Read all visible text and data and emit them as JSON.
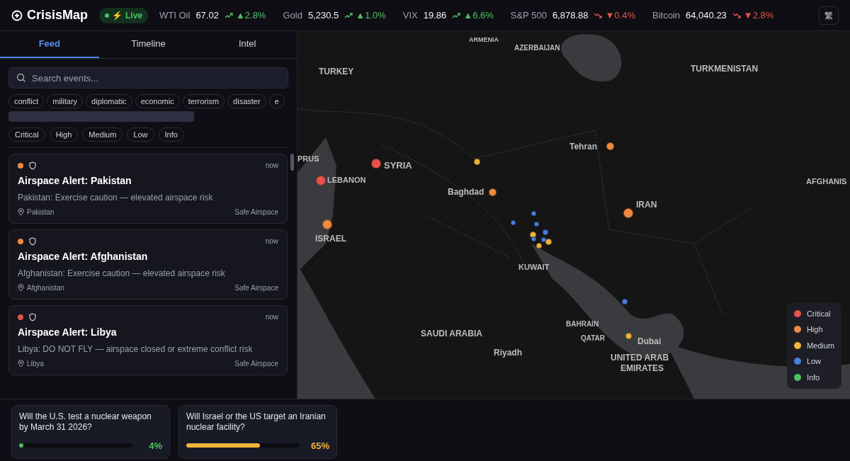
{
  "app": {
    "name": "CrisisMap",
    "status_icon": "⚡",
    "status": "Live"
  },
  "ticker": [
    {
      "label": "WTI Oil",
      "value": "67.02",
      "change": "▲2.8%",
      "kind": "up"
    },
    {
      "label": "Gold",
      "value": "5,230.5",
      "change": "▲1.0%",
      "kind": "up"
    },
    {
      "label": "VIX",
      "value": "19.86",
      "change": "▲6.6%",
      "kind": "up"
    },
    {
      "label": "S&P 500",
      "value": "6,878.88",
      "change": "▼0.4%",
      "kind": "down"
    },
    {
      "label": "Bitcoin",
      "value": "64,040.23",
      "change": "▼2.8%",
      "kind": "down"
    }
  ],
  "language_button": "繁",
  "tabs": [
    {
      "label": "Feed",
      "selected": true
    },
    {
      "label": "Timeline",
      "selected": false
    },
    {
      "label": "Intel",
      "selected": false
    }
  ],
  "search": {
    "placeholder": "Search events..."
  },
  "category_filters": [
    "conflict",
    "military",
    "diplomatic",
    "economic",
    "terrorism",
    "disaster",
    "e"
  ],
  "severity_filters": [
    "Critical",
    "High",
    "Medium",
    "Low",
    "Info"
  ],
  "events": [
    {
      "color": "#f08a3c",
      "time": "now",
      "title": "Airspace Alert: Pakistan",
      "description": "Pakistan: Exercise caution — elevated airspace risk",
      "location": "Pakistan",
      "source": "Safe Airspace"
    },
    {
      "color": "#f08a3c",
      "time": "now",
      "title": "Airspace Alert: Afghanistan",
      "description": "Afghanistan: Exercise caution — elevated airspace risk",
      "location": "Afghanistan",
      "source": "Safe Airspace"
    },
    {
      "color": "#e5534b",
      "time": "now",
      "title": "Airspace Alert: Libya",
      "description": "Libya: DO NOT FLY — airspace closed or extreme conflict risk",
      "location": "Libya",
      "source": "Safe Airspace"
    }
  ],
  "map": {
    "labels": [
      {
        "text": "ARMENIA"
      },
      {
        "text": "AZERBAIJAN"
      },
      {
        "text": "TURKEY"
      },
      {
        "text": "TURKMENISTAN"
      },
      {
        "text": "PRUS"
      },
      {
        "text": "SYRIA"
      },
      {
        "text": "Tehran"
      },
      {
        "text": "LEBANON"
      },
      {
        "text": "Baghdad"
      },
      {
        "text": "AFGHANIS"
      },
      {
        "text": "IRAN"
      },
      {
        "text": "ISRAEL"
      },
      {
        "text": "KUWAIT"
      },
      {
        "text": "BAHRAIN"
      },
      {
        "text": "SAUDI ARABIA"
      },
      {
        "text": "QATAR"
      },
      {
        "text": "Dubai"
      },
      {
        "text": "Riyadh"
      },
      {
        "text": "UNITED ARAB"
      },
      {
        "text": "EMIRATES"
      }
    ],
    "markers": [
      {
        "color": "#e5534b"
      },
      {
        "color": "#e5534b"
      },
      {
        "color": "#f08a3c"
      },
      {
        "color": "#f08a3c"
      },
      {
        "color": "#f08a3c"
      },
      {
        "color": "#f08a3c"
      },
      {
        "color": "#f2b53a"
      },
      {
        "color": "#4a7fe0"
      },
      {
        "color": "#4a7fe0"
      },
      {
        "color": "#4a7fe0"
      },
      {
        "color": "#f2b53a"
      },
      {
        "color": "#4a7fe0"
      },
      {
        "color": "#4a7fe0"
      },
      {
        "color": "#f2b53a"
      },
      {
        "color": "#f2b53a"
      },
      {
        "color": "#4a7fe0"
      },
      {
        "color": "#4a7fe0"
      },
      {
        "color": "#f2b53a"
      }
    ],
    "legend": [
      {
        "label": "Critical",
        "color": "#e5534b"
      },
      {
        "label": "High",
        "color": "#f08a3c"
      },
      {
        "label": "Medium",
        "color": "#f2b53a"
      },
      {
        "label": "Low",
        "color": "#4a7fe0"
      },
      {
        "label": "Info",
        "color": "#4cc265"
      }
    ]
  },
  "predictions": [
    {
      "question": "Will the U.S. test a nuclear weapon by March 31 2026?",
      "level": 0.04,
      "percent": "4%",
      "color": "#4cc265"
    },
    {
      "question": "Will Israel or the US target an Iranian nuclear facility?",
      "level": 0.65,
      "percent": "65%",
      "color": "#f2b53a"
    }
  ]
}
